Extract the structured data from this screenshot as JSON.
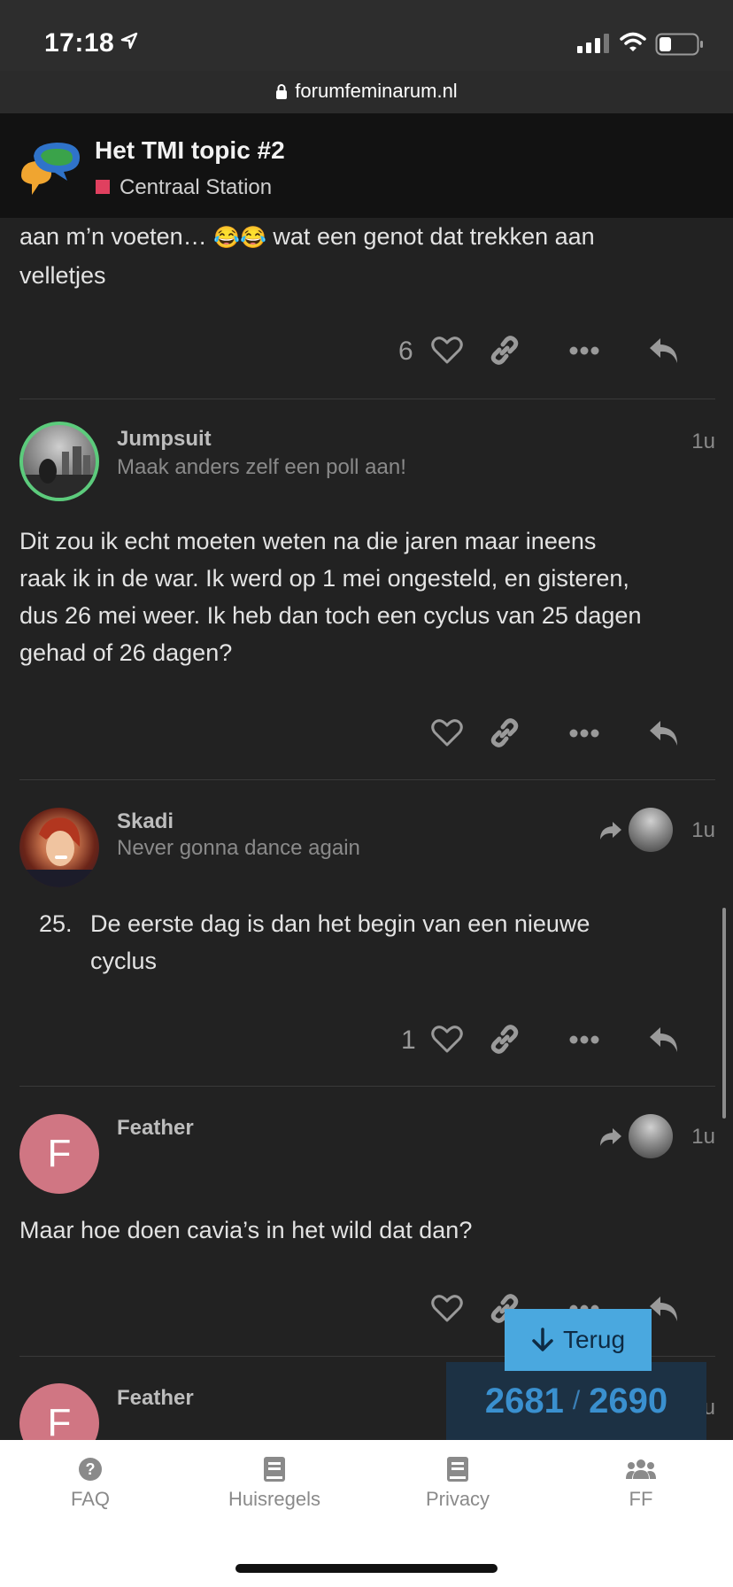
{
  "status_bar": {
    "time": "17:18",
    "battery_level": 0.3
  },
  "browser": {
    "url": "forumfeminarum.nl"
  },
  "topic": {
    "title": "Het TMI topic #2",
    "category": "Centraal Station",
    "category_color": "#e0405f"
  },
  "posts": [
    {
      "body": "aan m’n voeten…",
      "emoji": "😂😂",
      "body_rest": "wat een genot dat trekken aan",
      "body_line2": "velletjes",
      "likes": "6"
    },
    {
      "username": "Jumpsuit",
      "user_title": "Maak anders zelf een poll aan!",
      "date": "1u",
      "body_lines": [
        "Dit zou ik echt moeten weten na die jaren maar ineens",
        "raak ik in de war. Ik werd op 1 mei ongesteld, en gisteren,",
        "dus 26 mei weer. Ik heb dan toch een cyclus van 25 dagen",
        "gehad of 26 dagen?"
      ]
    },
    {
      "username": "Skadi",
      "user_title": "Never gonna dance again",
      "date": "1u",
      "list_number": "25.",
      "body_lines": [
        "De eerste dag is dan het begin van een nieuwe",
        "cyclus"
      ],
      "likes": "1"
    },
    {
      "username": "Feather",
      "avatar_letter": "F",
      "date": "1u",
      "body_lines": [
        "Maar hoe doen cavia’s in het wild dat dan?"
      ]
    },
    {
      "username": "Feather",
      "avatar_letter": "F",
      "date": "1u"
    }
  ],
  "timeline": {
    "back_label": "Terug",
    "current": "2681",
    "separator": "/",
    "total": "2690"
  },
  "bottom_nav": [
    {
      "label": "FAQ",
      "icon": "question-circle-icon"
    },
    {
      "label": "Huisregels",
      "icon": "book-icon"
    },
    {
      "label": "Privacy",
      "icon": "book-icon"
    },
    {
      "label": "FF",
      "icon": "users-icon"
    }
  ],
  "colors": {
    "background": "#222222",
    "header": "#121212",
    "accent": "#4aa8df",
    "avatar_ring": "#5ccb7c",
    "feather_avatar": "#d07683"
  }
}
